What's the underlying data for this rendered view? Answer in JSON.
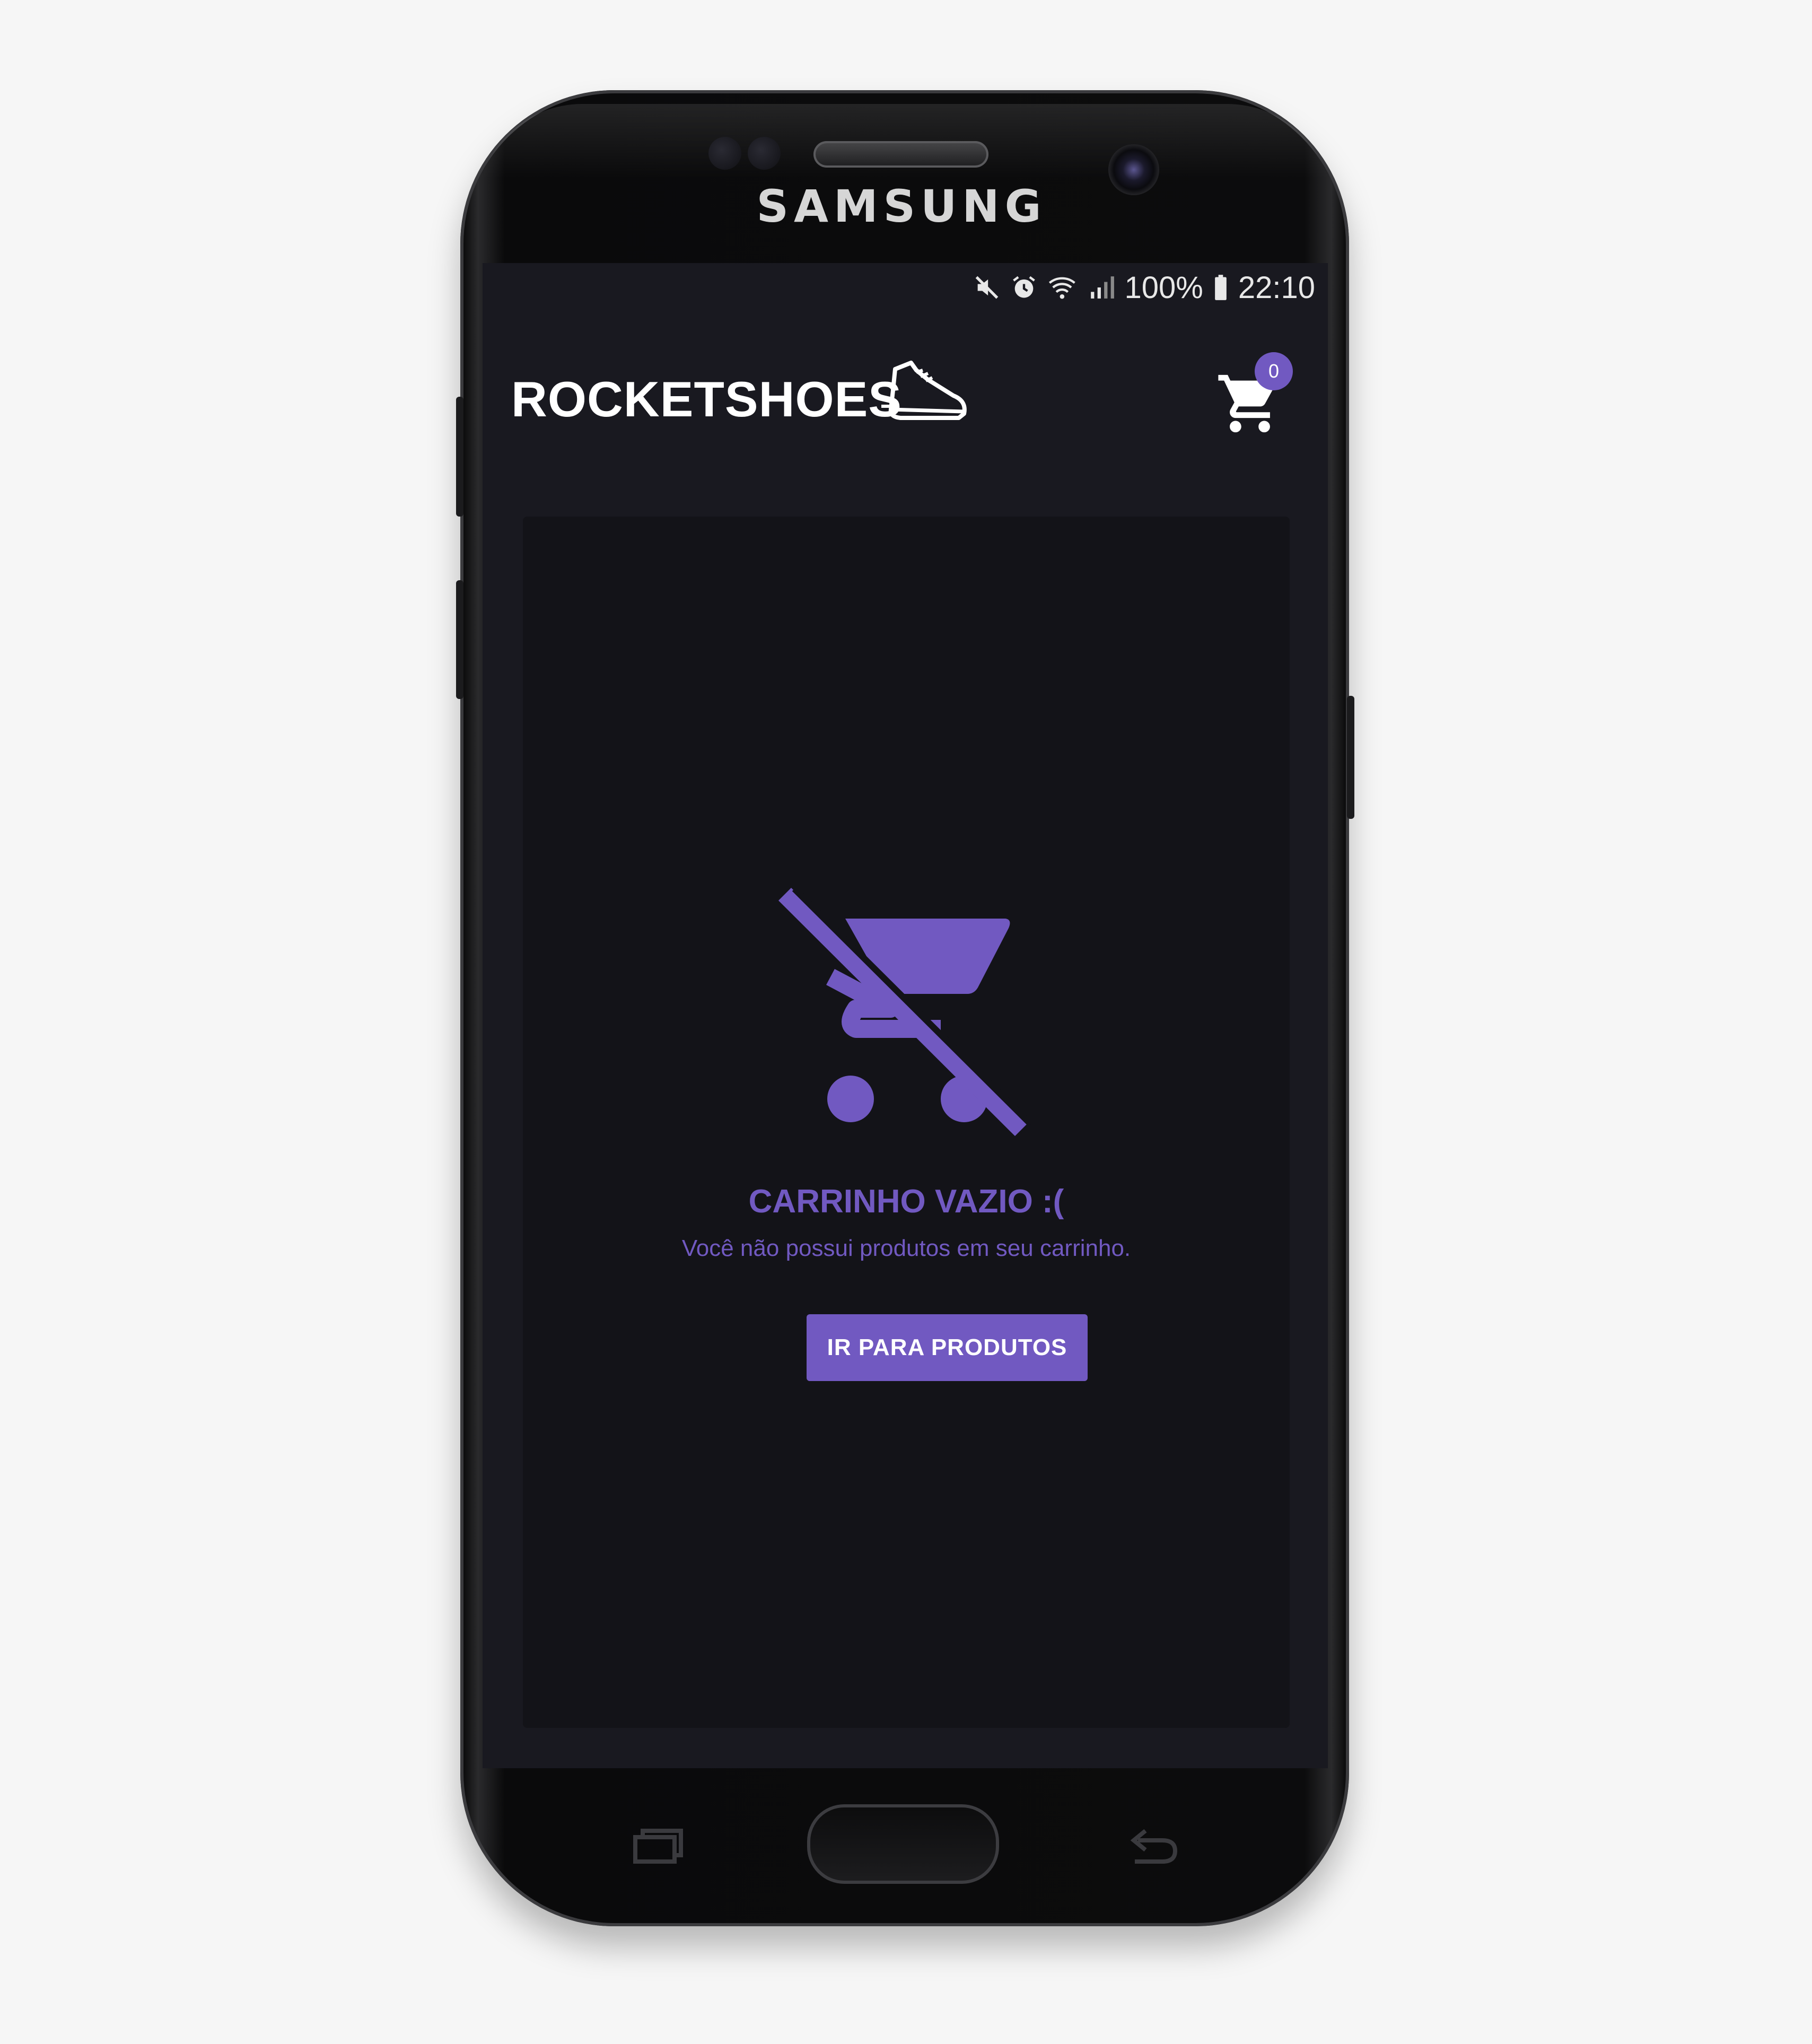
{
  "device": {
    "brand": "SAMSUNG"
  },
  "status_bar": {
    "battery": "100%",
    "time": "22:10",
    "icons": [
      "mute-icon",
      "alarm-icon",
      "wifi-icon",
      "signal-icon",
      "battery-icon"
    ]
  },
  "header": {
    "logo_text": "ROCKETSHOES",
    "logo_icon": "running-shoe-icon",
    "cart_icon": "shopping-cart-icon",
    "cart_count": "0"
  },
  "empty_cart": {
    "icon": "remove-shopping-cart-icon",
    "title": "CARRINHO VAZIO :(",
    "subtitle": "Você não possui produtos em seu carrinho.",
    "button_label": "IR PARA PRODUTOS"
  },
  "theme": {
    "accent": "#7159c1",
    "background": "#191920",
    "card": "#131318",
    "text_light": "#ffffff"
  },
  "navigation_keys": [
    "recent-apps-icon",
    "home-button",
    "back-icon"
  ]
}
